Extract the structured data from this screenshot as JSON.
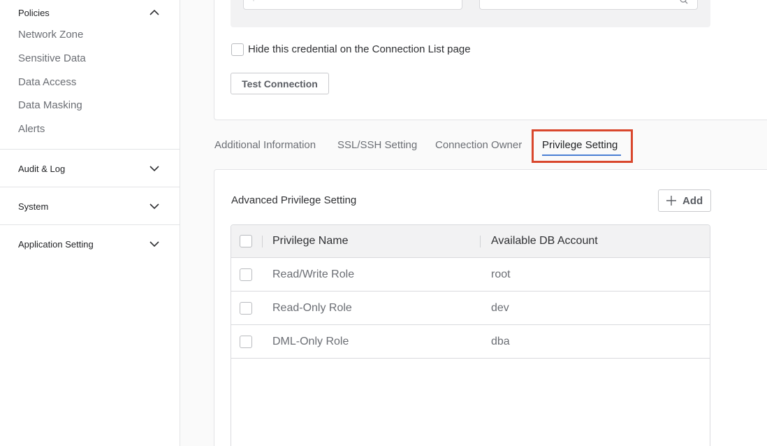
{
  "sidebar": {
    "policies": {
      "label": "Policies",
      "items": [
        "Network Zone",
        "Sensitive Data",
        "Data Access",
        "Data Masking",
        "Alerts"
      ]
    },
    "audit_log": {
      "label": "Audit & Log"
    },
    "system": {
      "label": "System"
    },
    "application_setting": {
      "label": "Application Setting"
    }
  },
  "credential": {
    "hide_label": "Hide this credential on the Connection List page",
    "test_connection_label": "Test Connection"
  },
  "tabs": [
    {
      "label": "Additional Information"
    },
    {
      "label": "SSL/SSH Setting"
    },
    {
      "label": "Connection Owner"
    },
    {
      "label": "Privilege Setting",
      "active": true
    }
  ],
  "privilege": {
    "title": "Advanced Privilege Setting",
    "add_label": "Add",
    "columns": [
      "Privilege Name",
      "Available DB Account"
    ],
    "rows": [
      {
        "name": "Read/Write Role",
        "account": "root"
      },
      {
        "name": "Read-Only Role",
        "account": "dev"
      },
      {
        "name": "DML-Only Role",
        "account": "dba"
      }
    ]
  },
  "colors": {
    "accent": "#4a7fd4",
    "highlight": "#d9472d"
  }
}
